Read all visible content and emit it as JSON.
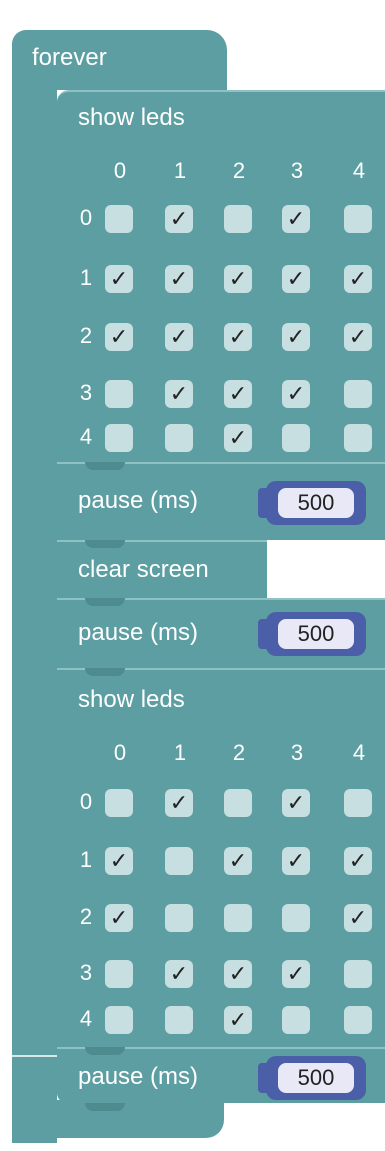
{
  "forever": {
    "label": "forever"
  },
  "blocks": [
    {
      "type": "show_leds",
      "label": "show leds",
      "col_headers": [
        "0",
        "1",
        "2",
        "3",
        "4"
      ],
      "row_headers": [
        "0",
        "1",
        "2",
        "3",
        "4"
      ],
      "grid": [
        [
          0,
          1,
          0,
          1,
          0
        ],
        [
          1,
          1,
          1,
          1,
          1
        ],
        [
          1,
          1,
          1,
          1,
          1
        ],
        [
          0,
          1,
          1,
          1,
          0
        ],
        [
          0,
          0,
          1,
          0,
          0
        ]
      ]
    },
    {
      "type": "pause",
      "label": "pause (ms)",
      "value": "500"
    },
    {
      "type": "clear_screen",
      "label": "clear screen"
    },
    {
      "type": "pause",
      "label": "pause (ms)",
      "value": "500"
    },
    {
      "type": "show_leds",
      "label": "show leds",
      "col_headers": [
        "0",
        "1",
        "2",
        "3",
        "4"
      ],
      "row_headers": [
        "0",
        "1",
        "2",
        "3",
        "4"
      ],
      "grid": [
        [
          0,
          1,
          0,
          1,
          0
        ],
        [
          1,
          0,
          1,
          1,
          1
        ],
        [
          1,
          0,
          0,
          0,
          1
        ],
        [
          0,
          1,
          1,
          1,
          0
        ],
        [
          0,
          0,
          1,
          0,
          0
        ]
      ]
    },
    {
      "type": "pause",
      "label": "pause (ms)",
      "value": "500"
    }
  ],
  "check_mark": "✓",
  "colors": {
    "block_teal": "#5c9ea2",
    "cell_off": "#c8dfe1",
    "number_block": "#4a5fa8",
    "number_field": "#e8e8f6"
  }
}
